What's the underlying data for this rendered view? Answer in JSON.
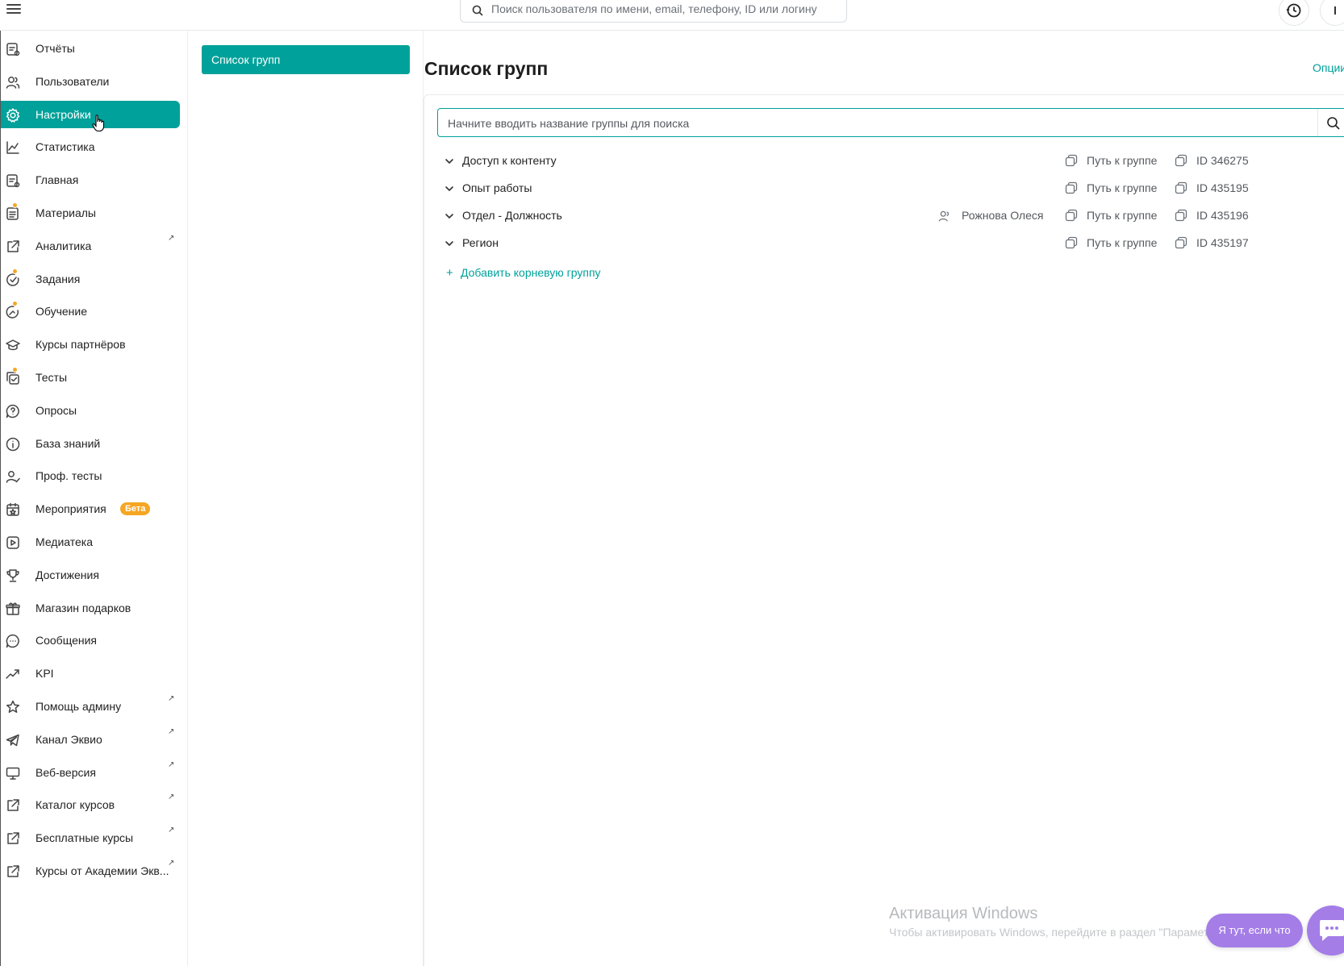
{
  "topbar": {
    "user_search_placeholder": "Поиск пользователя по имени, email, телефону, ID или логину"
  },
  "sidebar": {
    "items": [
      {
        "label": "Отчёты",
        "icon": "report-icon"
      },
      {
        "label": "Пользователи",
        "icon": "users-icon"
      },
      {
        "label": "Настройки",
        "icon": "gear-icon",
        "active": true
      },
      {
        "label": "Статистика",
        "icon": "chart-line-icon"
      },
      {
        "label": "Главная",
        "icon": "home-feed-icon"
      },
      {
        "label": "Материалы",
        "icon": "materials-icon",
        "dot": true
      },
      {
        "label": "Аналитика",
        "icon": "external-link-icon",
        "external": true
      },
      {
        "label": "Задания",
        "icon": "tasks-icon",
        "dot": true
      },
      {
        "label": "Обучение",
        "icon": "learning-icon",
        "dot": true
      },
      {
        "label": "Курсы партнёров",
        "icon": "graduation-cap-icon"
      },
      {
        "label": "Тесты",
        "icon": "tests-icon",
        "dot": true
      },
      {
        "label": "Опросы",
        "icon": "question-bubble-icon"
      },
      {
        "label": "База знаний",
        "icon": "info-icon"
      },
      {
        "label": "Проф. тесты",
        "icon": "user-check-icon"
      },
      {
        "label": "Мероприятия",
        "icon": "calendar-star-icon",
        "badge": "Бета"
      },
      {
        "label": "Медиатека",
        "icon": "play-icon"
      },
      {
        "label": "Достижения",
        "icon": "trophy-icon"
      },
      {
        "label": "Магазин подарков",
        "icon": "gift-icon"
      },
      {
        "label": "Сообщения",
        "icon": "chat-icon"
      },
      {
        "label": "KPI",
        "icon": "trend-up-icon"
      },
      {
        "label": "Помощь админу",
        "icon": "star-icon",
        "external": true
      },
      {
        "label": "Канал Эквио",
        "icon": "telegram-icon",
        "external": true
      },
      {
        "label": "Веб-версия",
        "icon": "monitor-icon",
        "external": true
      },
      {
        "label": "Каталог курсов",
        "icon": "external-link-icon",
        "external": true
      },
      {
        "label": "Бесплатные курсы",
        "icon": "external-link-icon",
        "external": true
      },
      {
        "label": "Курсы от Академии Экв...",
        "icon": "external-link-icon",
        "external": true
      }
    ],
    "external_mark": "↗"
  },
  "subnav": {
    "active_label": "Список групп"
  },
  "main": {
    "title": "Список групп",
    "options_label": "Опции",
    "search_placeholder": "Начните вводить название группы для поиска",
    "path_label": "Путь к группе",
    "groups": [
      {
        "name": "Доступ к контенту",
        "owner": "",
        "id": "ID 346275"
      },
      {
        "name": "Опыт работы",
        "owner": "",
        "id": "ID 435195"
      },
      {
        "name": "Отдел - Должность",
        "owner": "Рожнова Олеся",
        "id": "ID 435196"
      },
      {
        "name": "Регион",
        "owner": "",
        "id": "ID 435197"
      }
    ],
    "add_root_label": "Добавить корневую группу",
    "add_root_plus": "+"
  },
  "watermark": {
    "title": "Активация Windows",
    "subtitle": "Чтобы активировать Windows, перейдите в раздел \"Параметры\"."
  },
  "help": {
    "pill_label": "Я тут, если что"
  },
  "colors": {
    "accent": "#00a19a",
    "badge": "#f5a623",
    "help": "#a47de7"
  }
}
